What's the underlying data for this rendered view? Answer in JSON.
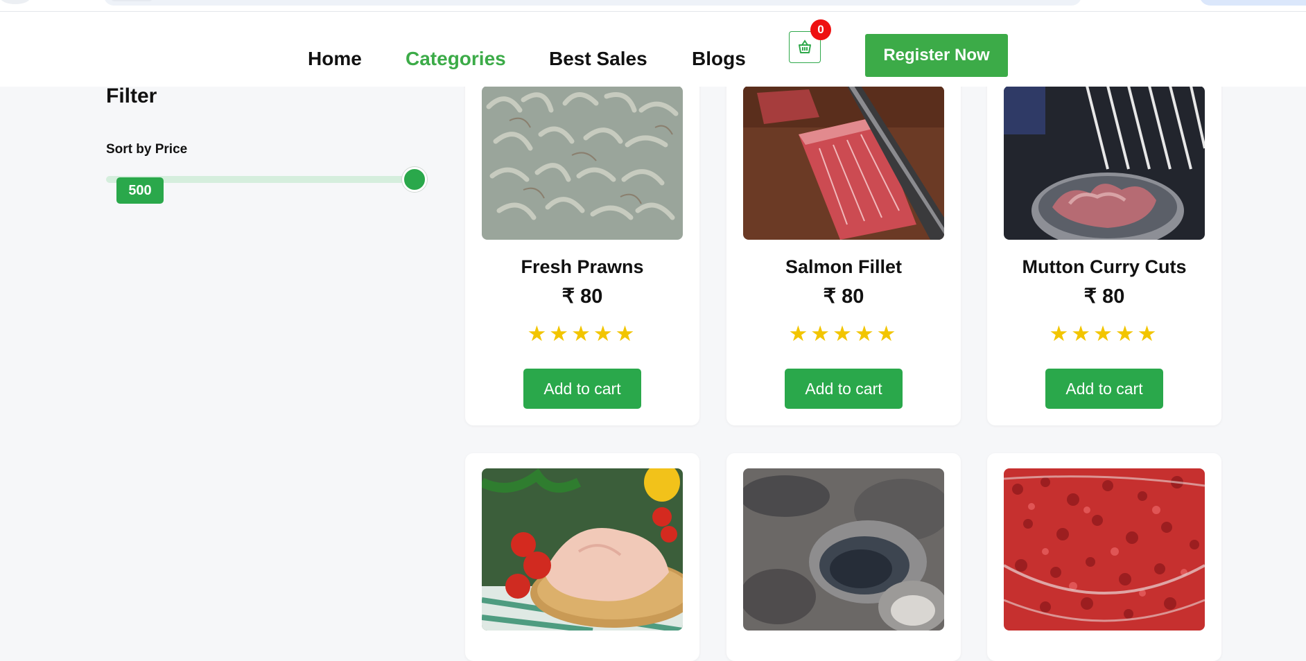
{
  "nav": {
    "links": [
      "Home",
      "Categories",
      "Best Sales",
      "Blogs"
    ],
    "active": "Categories",
    "cart_count": "0",
    "register_label": "Register Now"
  },
  "filter": {
    "title": "Filter",
    "sort_label": "Sort by Price",
    "price_value": "500"
  },
  "colors": {
    "brand_green": "#2aa84b",
    "active_link": "#3cab48",
    "badge_red": "#ee1111",
    "star": "#f2c500"
  },
  "products": [
    {
      "name": "Fresh Prawns",
      "price": "₹ 80",
      "stars": "★★★★★",
      "rating": 5,
      "cta": "Add to cart",
      "image": "prawns"
    },
    {
      "name": "Salmon Fillet",
      "price": "₹ 80",
      "stars": "★★★★★",
      "rating": 5,
      "cta": "Add to cart",
      "image": "raw-meat-block"
    },
    {
      "name": "Mutton Curry Cuts",
      "price": "₹ 80",
      "stars": "★★★★★",
      "rating": 5,
      "cta": "Add to cart",
      "image": "mutton-bowl"
    },
    {
      "image": "chicken-breast"
    },
    {
      "image": "oysters"
    },
    {
      "image": "minced-meat"
    }
  ]
}
